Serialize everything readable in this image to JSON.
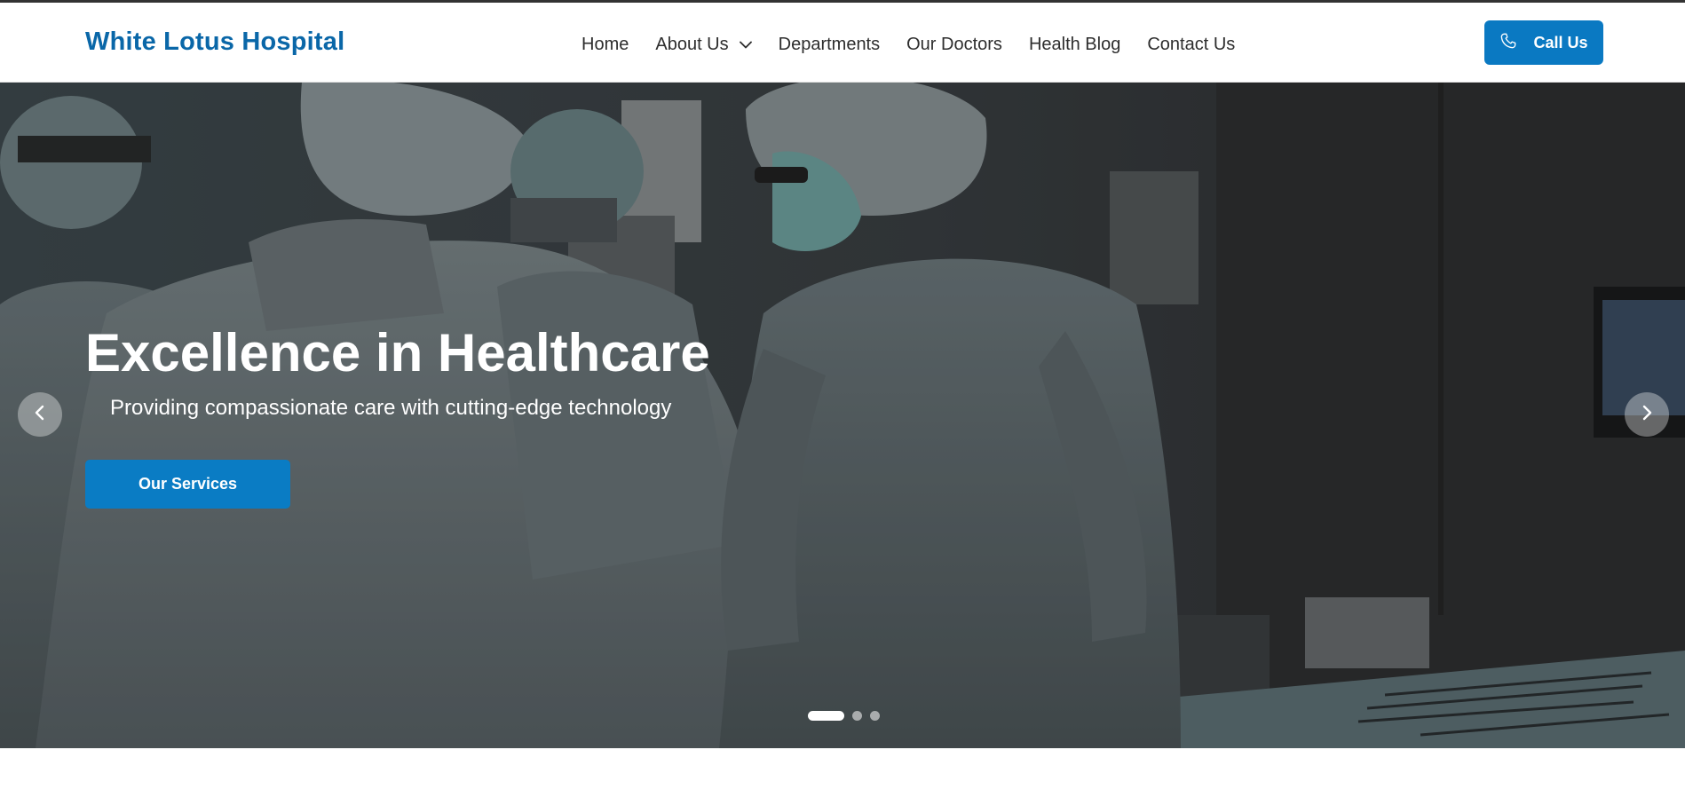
{
  "brand": {
    "name": "White Lotus Hospital",
    "color": "#0a67a8"
  },
  "nav": {
    "items": [
      {
        "label": "Home"
      },
      {
        "label": "About Us",
        "icon": "chevron-down-icon"
      },
      {
        "label": "Departments"
      },
      {
        "label": "Our Doctors"
      },
      {
        "label": "Health Blog"
      },
      {
        "label": "Contact Us"
      }
    ]
  },
  "call_button": {
    "label": "Call Us",
    "icon": "phone-icon",
    "color": "#0a79c2"
  },
  "hero": {
    "title": "Excellence in Healthcare",
    "subtitle": "Providing compassionate care with cutting-edge technology",
    "cta_label": "Our Services",
    "cta_color": "#0a7cc4",
    "prev_icon": "chevron-left-icon",
    "next_icon": "chevron-right-icon",
    "slide_count": 3,
    "active_slide": 1
  }
}
